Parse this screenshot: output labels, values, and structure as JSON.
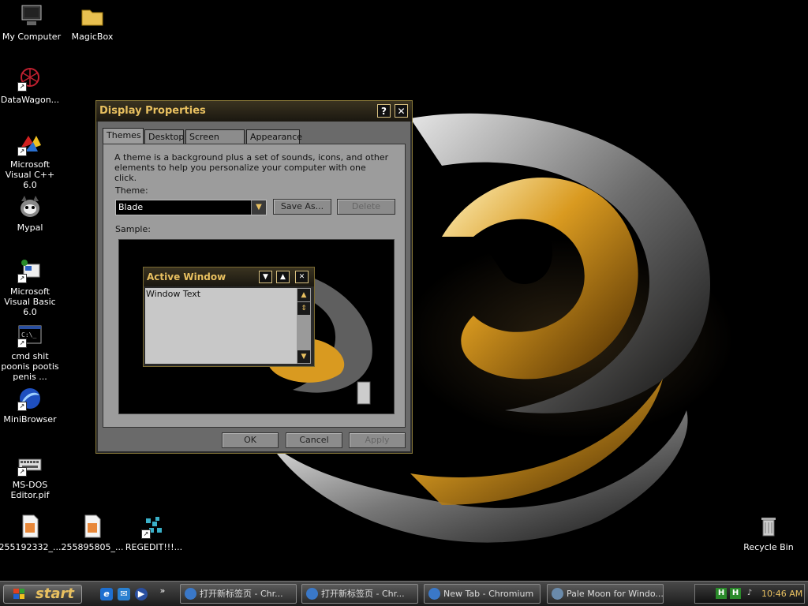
{
  "desktop": {
    "icons": [
      {
        "label": "My Computer",
        "icon": "my-computer-icon"
      },
      {
        "label": "MagicBox",
        "icon": "folder-icon"
      },
      {
        "label": "DataWagon...",
        "icon": "datawagon-icon"
      },
      {
        "label": "Microsoft Visual C++ 6.0",
        "icon": "visual-cpp-icon"
      },
      {
        "label": "Mypal",
        "icon": "mypal-icon"
      },
      {
        "label": "Microsoft Visual Basic 6.0",
        "icon": "visual-basic-icon"
      },
      {
        "label": "cmd shit poonis pootis penis ...",
        "icon": "cmd-icon"
      },
      {
        "label": "MiniBrowser",
        "icon": "minibrowser-icon"
      },
      {
        "label": "MS-DOS Editor.pif",
        "icon": "keyboard-icon"
      },
      {
        "label": "255192332_...",
        "icon": "image-file-icon"
      },
      {
        "label": "255895805_...",
        "icon": "image-file-icon"
      },
      {
        "label": "REGEDIT!!!...",
        "icon": "regedit-icon"
      },
      {
        "label": "Recycle Bin",
        "icon": "recycle-bin-icon"
      }
    ]
  },
  "dialog": {
    "title": "Display Properties",
    "help_button": "?",
    "close_button": "✕",
    "tabs": [
      "Themes",
      "Desktop",
      "Screen Saver",
      "Appearance"
    ],
    "active_tab": "Themes",
    "description": "A theme is a background plus a set of sounds, icons, and other elements to help you personalize your computer with one click.",
    "theme_label": "Theme:",
    "theme_value": "Blade",
    "save_as": "Save As...",
    "delete": "Delete",
    "sample_label": "Sample:",
    "sample_window": {
      "title": "Active Window",
      "text": "Window Text"
    },
    "ok": "OK",
    "cancel": "Cancel",
    "apply": "Apply"
  },
  "taskbar": {
    "start_label": "start",
    "quick_launch": [
      "ie-icon",
      "outlook-icon",
      "media-player-icon"
    ],
    "overflow": "»",
    "tasks": [
      {
        "label": "打开新标签页 - Chr..."
      },
      {
        "label": "打开新标签页 - Chr..."
      },
      {
        "label": "New Tab - Chromium"
      },
      {
        "label": "Pale Moon for Windo..."
      }
    ],
    "tray_icons": [
      "H",
      "H"
    ],
    "clock": "10:46 AM"
  },
  "colors": {
    "accent": "#e8c060",
    "dialog_bg": "#9c9c9c",
    "titlebar": "#2a2418"
  }
}
